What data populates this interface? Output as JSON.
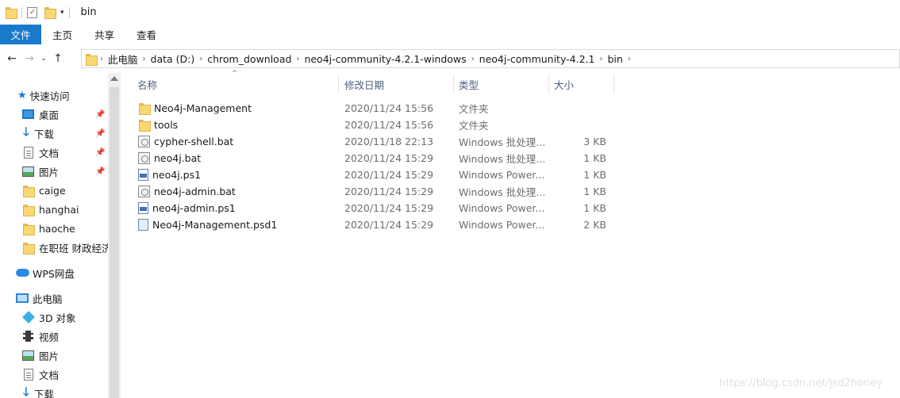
{
  "titlebar": {
    "title": "bin"
  },
  "ribbon": {
    "tabs": [
      "文件",
      "主页",
      "共享",
      "查看"
    ]
  },
  "address": {
    "crumbs": [
      "此电脑",
      "data (D:)",
      "chrom_download",
      "neo4j-community-4.2.1-windows",
      "neo4j-community-4.2.1",
      "bin"
    ]
  },
  "nav": {
    "quick_access": "快速访问",
    "items": [
      {
        "label": "桌面",
        "icon": "desktop-icon"
      },
      {
        "label": "下载",
        "icon": "download-icon"
      },
      {
        "label": "文档",
        "icon": "document-icon"
      },
      {
        "label": "图片",
        "icon": "pictures-icon"
      },
      {
        "label": "caige",
        "icon": "folder-icon"
      },
      {
        "label": "hanghai",
        "icon": "folder-icon"
      },
      {
        "label": "haoche",
        "icon": "folder-icon"
      },
      {
        "label": "在职班 财政经济",
        "icon": "folder-icon"
      }
    ],
    "wps": "WPS网盘",
    "this_pc": "此电脑",
    "pc_items": [
      {
        "label": "3D 对象",
        "icon": "3d-objects-icon"
      },
      {
        "label": "视频",
        "icon": "video-icon"
      },
      {
        "label": "图片",
        "icon": "pictures-icon"
      },
      {
        "label": "文档",
        "icon": "document-icon"
      },
      {
        "label": "下载",
        "icon": "download-icon"
      }
    ]
  },
  "columns": {
    "name": "名称",
    "date": "修改日期",
    "type": "类型",
    "size": "大小"
  },
  "files": [
    {
      "name": "Neo4j-Management",
      "date": "2020/11/24 15:56",
      "type": "文件夹",
      "size": "",
      "icon": "folder-icon"
    },
    {
      "name": "tools",
      "date": "2020/11/24 15:56",
      "type": "文件夹",
      "size": "",
      "icon": "folder-icon"
    },
    {
      "name": "cypher-shell.bat",
      "date": "2020/11/18 22:13",
      "type": "Windows 批处理...",
      "size": "3 KB",
      "icon": "batch-file-icon"
    },
    {
      "name": "neo4j.bat",
      "date": "2020/11/24 15:29",
      "type": "Windows 批处理...",
      "size": "1 KB",
      "icon": "batch-file-icon"
    },
    {
      "name": "neo4j.ps1",
      "date": "2020/11/24 15:29",
      "type": "Windows Power...",
      "size": "1 KB",
      "icon": "powershell-file-icon"
    },
    {
      "name": "neo4j-admin.bat",
      "date": "2020/11/24 15:29",
      "type": "Windows 批处理...",
      "size": "1 KB",
      "icon": "batch-file-icon"
    },
    {
      "name": "neo4j-admin.ps1",
      "date": "2020/11/24 15:29",
      "type": "Windows Power...",
      "size": "1 KB",
      "icon": "powershell-file-icon"
    },
    {
      "name": "Neo4j-Management.psd1",
      "date": "2020/11/24 15:29",
      "type": "Windows Power...",
      "size": "2 KB",
      "icon": "psd1-file-icon"
    }
  ],
  "watermark": "https://blog.csdn.net/jsd2honey"
}
